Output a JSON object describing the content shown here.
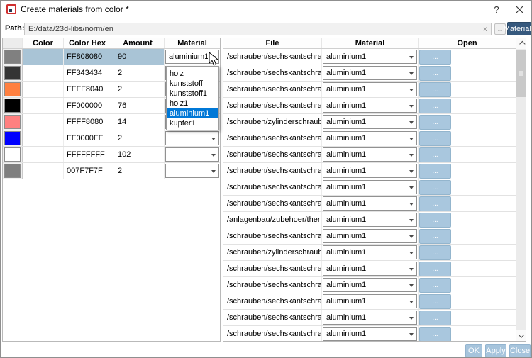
{
  "window": {
    "title": "Create materials from color *",
    "help_label": "?"
  },
  "path": {
    "label": "Path:",
    "value": "E:/data/23d-libs/norm/en",
    "clear_label": "x",
    "browse_label": "...",
    "materials_label": "Materials"
  },
  "left_table": {
    "columns": [
      "Color",
      "Color Hex",
      "Amount",
      "Material"
    ],
    "rows": [
      {
        "color": "#808080",
        "hex": "FF808080",
        "amount": "90",
        "material": "aluminium1",
        "selected": true
      },
      {
        "color": "#343434",
        "hex": "FF343434",
        "amount": "2",
        "material": "",
        "selected": false
      },
      {
        "color": "#ff8040",
        "hex": "FFFF8040",
        "amount": "2",
        "material": "",
        "selected": false
      },
      {
        "color": "#000000",
        "hex": "FF000000",
        "amount": "76",
        "material": "",
        "selected": false
      },
      {
        "color": "#ff8080",
        "hex": "FFFF8080",
        "amount": "14",
        "material": "",
        "selected": false
      },
      {
        "color": "#0000ff",
        "hex": "FF0000FF",
        "amount": "2",
        "material": "",
        "selected": false
      },
      {
        "color": "#ffffff",
        "hex": "FFFFFFFF",
        "amount": "102",
        "material": "",
        "selected": false
      },
      {
        "color": "#7f7f7f",
        "hex": "007F7F7F",
        "amount": "2",
        "material": "",
        "selected": false
      }
    ]
  },
  "dropdown": {
    "options": [
      "holz",
      "kunststoff",
      "kunststoff1",
      "holz1",
      "aluminium1",
      "kupfer1"
    ],
    "highlighted": "aluminium1"
  },
  "right_table": {
    "columns": [
      "File",
      "Material",
      "Open"
    ],
    "open_button_label": "...",
    "rows": [
      {
        "file": "/schrauben/sechskantschraub...",
        "material": "aluminium1"
      },
      {
        "file": "/schrauben/sechskantschraub...",
        "material": "aluminium1"
      },
      {
        "file": "/schrauben/sechskantschraub...",
        "material": "aluminium1"
      },
      {
        "file": "/schrauben/sechskantschraub...",
        "material": "aluminium1"
      },
      {
        "file": "/schrauben/zylinderschrauben...",
        "material": "aluminium1"
      },
      {
        "file": "/schrauben/sechskantschraub...",
        "material": "aluminium1"
      },
      {
        "file": "/schrauben/sechskantschraub...",
        "material": "aluminium1"
      },
      {
        "file": "/schrauben/sechskantschraub...",
        "material": "aluminium1"
      },
      {
        "file": "/schrauben/sechskantschraub...",
        "material": "aluminium1"
      },
      {
        "file": "/schrauben/sechskantschraub...",
        "material": "aluminium1"
      },
      {
        "file": "/anlagenbau/zubehoer/therm...",
        "material": "aluminium1"
      },
      {
        "file": "/schrauben/sechskantschraub...",
        "material": "aluminium1"
      },
      {
        "file": "/schrauben/zylinderschrauben...",
        "material": "aluminium1"
      },
      {
        "file": "/schrauben/sechskantschraub...",
        "material": "aluminium1"
      },
      {
        "file": "/schrauben/sechskantschraub...",
        "material": "aluminium1"
      },
      {
        "file": "/schrauben/sechskantschraub...",
        "material": "aluminium1"
      },
      {
        "file": "/schrauben/sechskantschraub...",
        "material": "aluminium1"
      },
      {
        "file": "/schrauben/sechskantschraub...",
        "material": "aluminium1"
      }
    ]
  },
  "footer": {
    "ok_label": "OK",
    "apply_label": "Apply",
    "close_label": "Close"
  },
  "colors": {
    "selection": "#a9c4d6",
    "dropdown_highlight": "#0078d7",
    "materials_button": "#36597e",
    "soft_button": "#a6c4dc",
    "open_button": "#a9c7de"
  }
}
